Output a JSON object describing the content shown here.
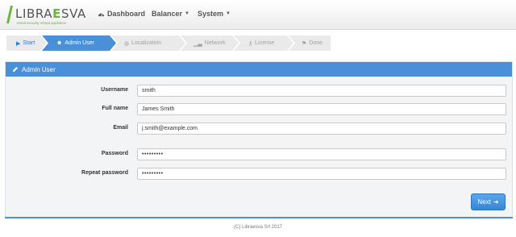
{
  "brand": {
    "name_part1": "LIBRA",
    "name_accent": "E",
    "name_part2": "SVA",
    "tagline": "email security virtual appliance"
  },
  "nav": {
    "dashboard": "Dashboard",
    "balancer": "Balancer",
    "system": "System"
  },
  "wizard": {
    "steps": [
      {
        "label": "Start",
        "icon": "play-icon",
        "state": "done"
      },
      {
        "label": "Admin User",
        "icon": "user-icon",
        "state": "active"
      },
      {
        "label": "Localization",
        "icon": "globe-icon",
        "state": "pending"
      },
      {
        "label": "Network",
        "icon": "signal-icon",
        "state": "pending"
      },
      {
        "label": "License",
        "icon": "key-icon",
        "state": "pending"
      },
      {
        "label": "Done",
        "icon": "flag-icon",
        "state": "pending"
      }
    ]
  },
  "panel": {
    "title": "Admin User",
    "title_icon": "pencil-icon"
  },
  "form": {
    "username_label": "Username",
    "username_value": "smith",
    "fullname_label": "Full name",
    "fullname_value": "James Smith",
    "email_label": "Email",
    "email_value": "j.smith@example.com",
    "password_label": "Password",
    "password_value": "•••••••••",
    "repeat_label": "Repeat password",
    "repeat_value": "•••••••••"
  },
  "actions": {
    "next_label": "Next"
  },
  "footer": {
    "text": "(C) Libraesva Srl 2017"
  },
  "colors": {
    "primary": "#4a90d9",
    "brand_green": "#6cb33f"
  }
}
